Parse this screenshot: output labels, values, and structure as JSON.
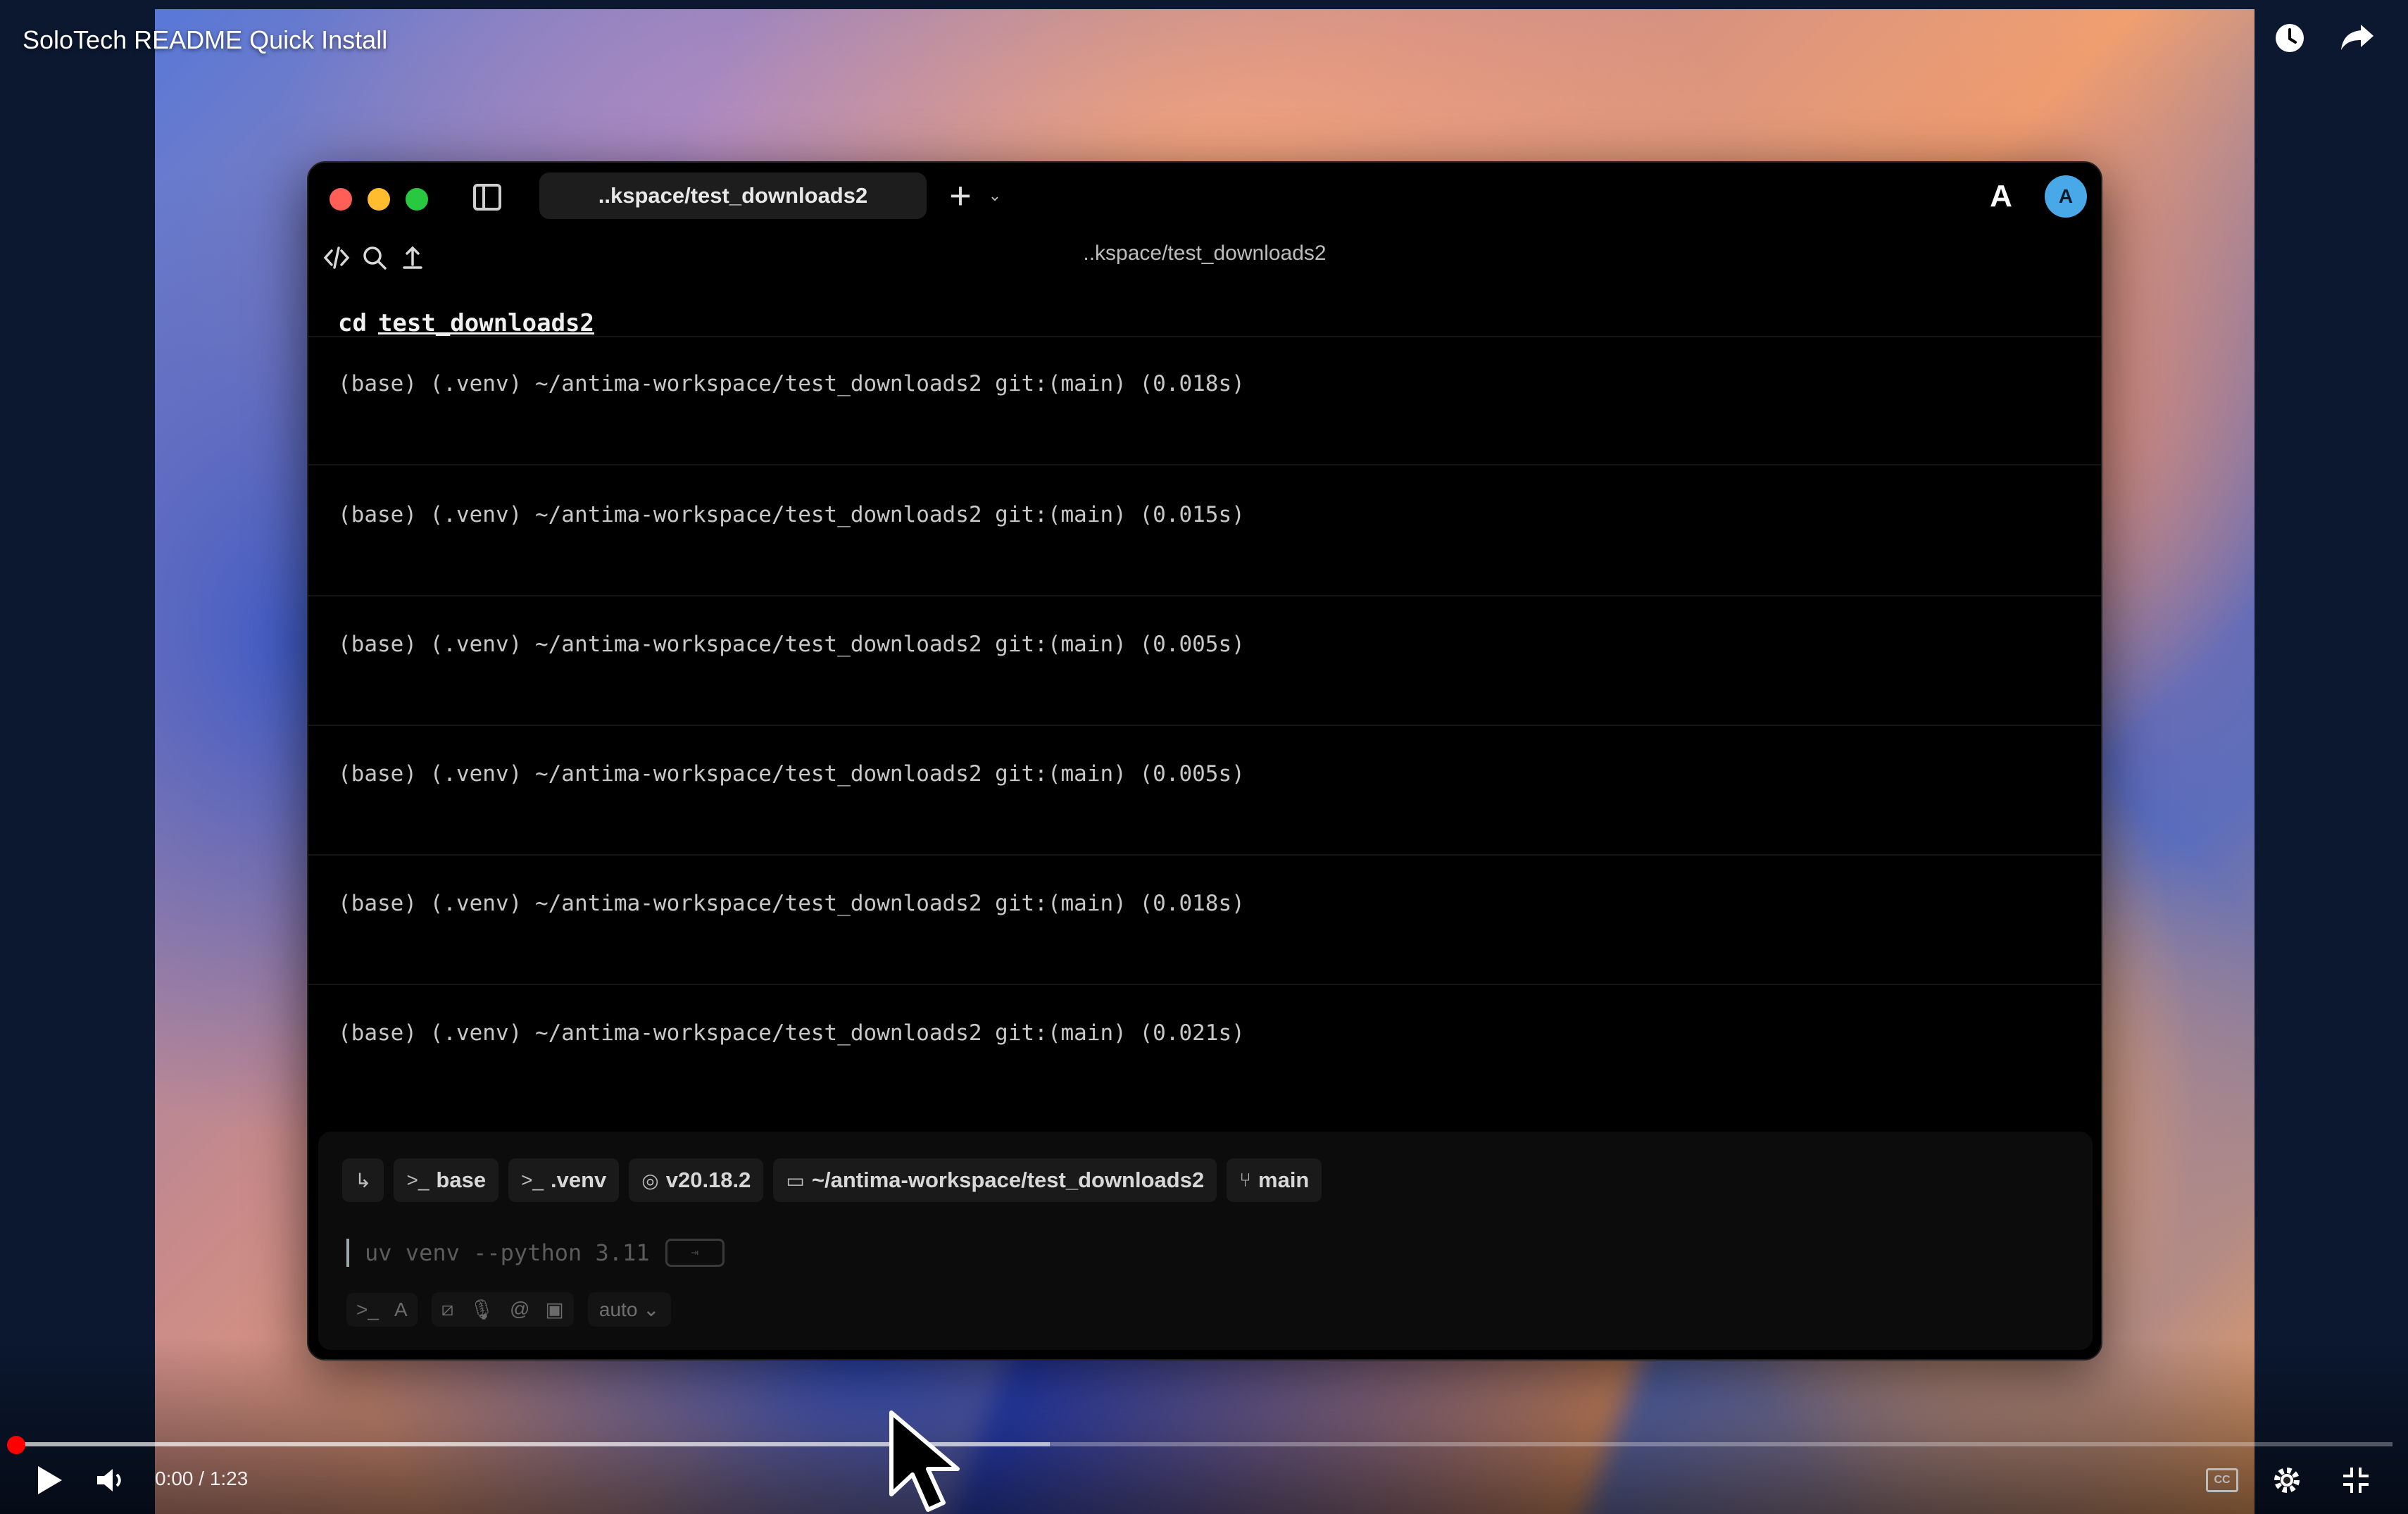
{
  "player": {
    "video_title": "SoloTech README Quick Install",
    "current_time": "0:00",
    "duration": "1:23",
    "time_display": "0:00 / 1:23",
    "played_fraction": 0.0,
    "buffered_fraction": 0.435,
    "cc_label": "CC",
    "icons": [
      "clock-icon",
      "share-icon",
      "play-icon",
      "volume-icon",
      "captions-icon",
      "gear-icon",
      "exit-fullscreen-icon"
    ],
    "colors": {
      "progress_played": "#ff0000"
    }
  },
  "terminal": {
    "tab_title": "..kspace/test_downloads2",
    "path_header": "..kspace/test_downloads2",
    "avatar_letter": "A",
    "command": {
      "cmd": "cd",
      "arg": "test_downloads2"
    },
    "prompt_lines": [
      "(base) (.venv) ~/antima-workspace/test_downloads2 git:(main) (0.018s)",
      "(base) (.venv) ~/antima-workspace/test_downloads2 git:(main) (0.015s)",
      "(base) (.venv) ~/antima-workspace/test_downloads2 git:(main) (0.005s)",
      "(base) (.venv) ~/antima-workspace/test_downloads2 git:(main) (0.005s)",
      "(base) (.venv) ~/antima-workspace/test_downloads2 git:(main) (0.018s)",
      "(base) (.venv) ~/antima-workspace/test_downloads2 git:(main) (0.021s)"
    ],
    "context_chips": {
      "conda": "base",
      "venv": ".venv",
      "node": "v20.18.2",
      "directory": "~/antima-workspace/test_downloads2",
      "branch": "main"
    },
    "input": {
      "current_text": "uv venv --python 3.11",
      "mode": "auto"
    },
    "colors": {
      "avatar": "#49a8e8",
      "close": "#ff5f57",
      "minimize": "#febc2e",
      "zoom": "#28c840"
    }
  }
}
